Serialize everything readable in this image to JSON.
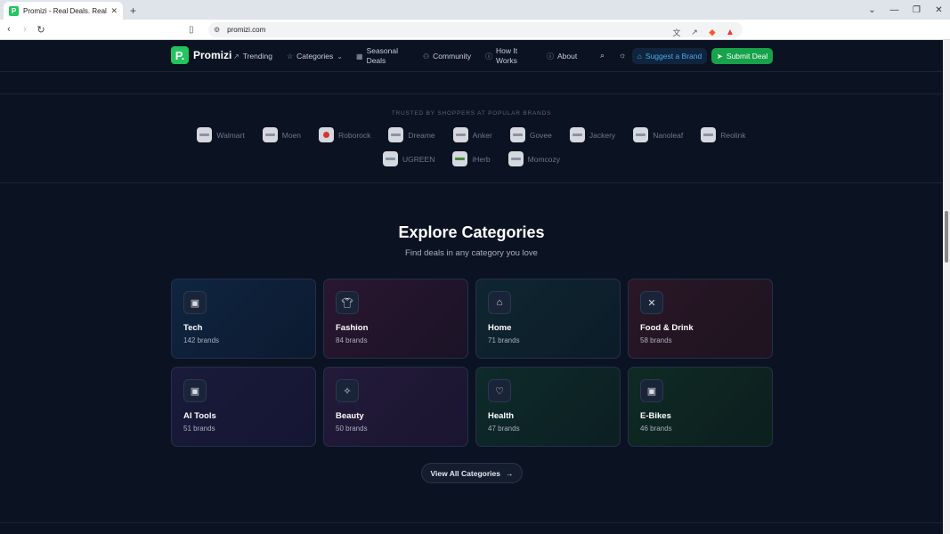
{
  "browser": {
    "tab_title": "Promizi - Real Deals. Real People.",
    "tab_close": "✕",
    "new_tab": "+",
    "url": "promizi.com",
    "win_controls": [
      "⌄",
      "—",
      "❐",
      "✕"
    ]
  },
  "nav": {
    "logo_badge": "P.",
    "logo_text": "Promizi",
    "trending": "Trending",
    "categories": "Categories",
    "seasonal_line1": "Seasonal",
    "seasonal_line2": "Deals",
    "community": "Community",
    "how_line1": "How It",
    "how_line2": "Works",
    "about": "About",
    "suggest": "Suggest a Brand",
    "submit": "Submit Deal"
  },
  "brands": {
    "heading": "TRUSTED BY SHOPPERS AT POPULAR BRANDS",
    "row1": [
      "Walmart",
      "Moen",
      "Roborock",
      "Dreame",
      "Anker",
      "Govee",
      "Jackery",
      "Nanoleaf",
      "Reolink"
    ],
    "row2": [
      "UGREEN",
      "iHerb",
      "Momcozy"
    ]
  },
  "categories": {
    "title": "Explore Categories",
    "subtitle": "Find deals in any category you love",
    "items": [
      {
        "name": "Tech",
        "count": "142 brands"
      },
      {
        "name": "Fashion",
        "count": "84 brands"
      },
      {
        "name": "Home",
        "count": "71 brands"
      },
      {
        "name": "Food & Drink",
        "count": "58 brands"
      },
      {
        "name": "AI Tools",
        "count": "51 brands"
      },
      {
        "name": "Beauty",
        "count": "50 brands"
      },
      {
        "name": "Health",
        "count": "47 brands"
      },
      {
        "name": "E-Bikes",
        "count": "46 brands"
      }
    ],
    "view_all": "View All Categories"
  },
  "colors": {
    "accent_green": "#22c55e",
    "suggest_blue": "#4aa8f0",
    "page_bg": "#0b1222"
  }
}
